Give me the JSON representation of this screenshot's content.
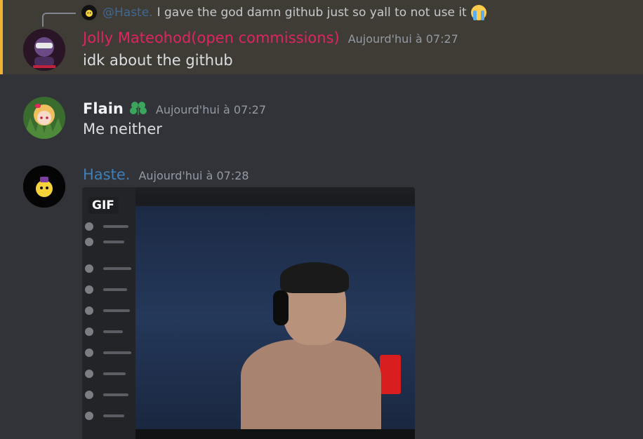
{
  "reply": {
    "username": "@Haste.",
    "text": "I gave the god damn github just so yall to not use it",
    "emoji": "loudly-crying-face"
  },
  "messages": [
    {
      "username": "Jolly Mateohod(open commissions)",
      "timestamp": "Aujourd'hui à 07:27",
      "content": "idk about the github",
      "name_color": "#e0245e",
      "highlighted": true
    },
    {
      "username": "Flain",
      "timestamp": "Aujourd'hui à 07:27",
      "content": "Me neither",
      "badge_icon": "clover-icon"
    },
    {
      "username": "Haste.",
      "timestamp": "Aujourd'hui à 07:28",
      "attachment": {
        "type": "gif",
        "badge": "GIF"
      }
    }
  ],
  "colors": {
    "background": "#313338",
    "highlight": "#3f3c36",
    "highlight_border": "#f0b232",
    "haste_blue": "#3e7fb8"
  }
}
